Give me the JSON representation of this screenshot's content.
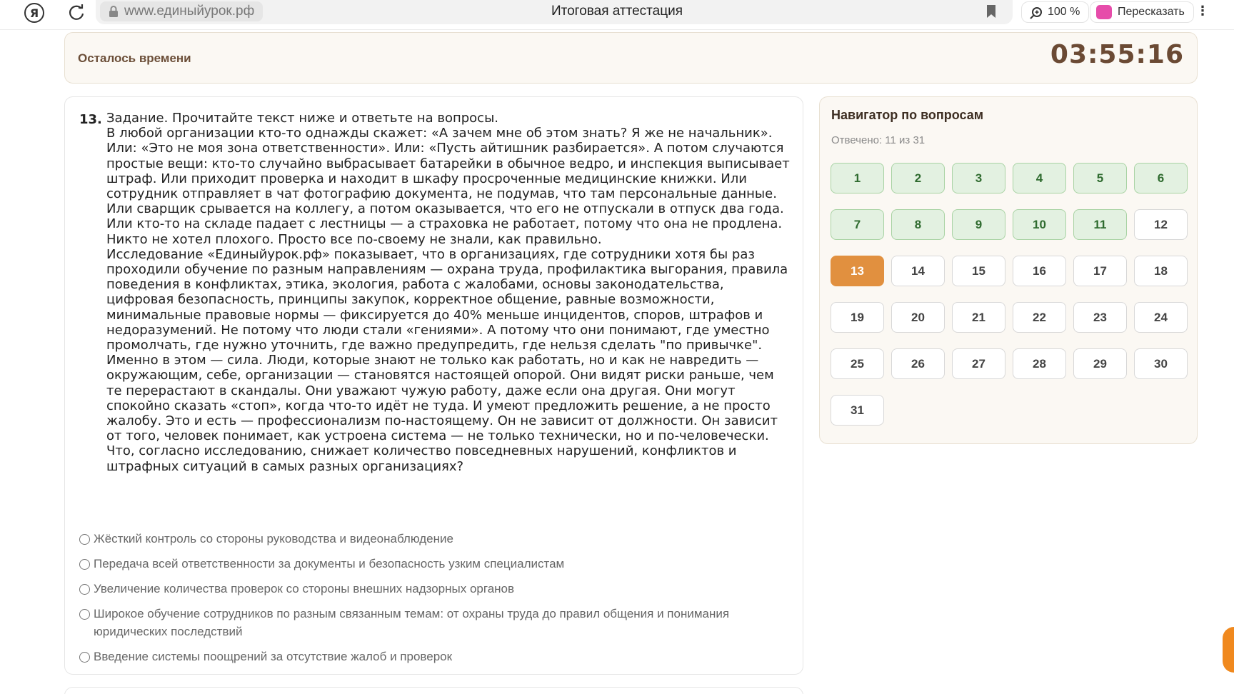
{
  "browser": {
    "url": "www.единыйурок.рф",
    "tab_title": "Итоговая аттестация",
    "zoom": "100 %",
    "retell_label": "Пересказать",
    "icons": [
      "yandex-icon",
      "reload-icon",
      "lock-icon",
      "bookmark-icon",
      "zoom-icon",
      "retell-icon",
      "menu-icon"
    ]
  },
  "timer": {
    "label": "Осталось времени",
    "value": "03:55:16"
  },
  "question": {
    "number": "13.",
    "paragraphs": [
      "Задание. Прочитайте текст ниже и ответьте на вопросы.",
      "В любой организации кто-то однажды скажет: «А зачем мне об этом знать? Я же не начальник». Или: «Это не моя зона ответственности». Или: «Пусть айтишник разбирается». А потом случаются простые вещи: кто-то случайно выбрасывает батарейки в обычное ведро, и инспекция выписывает штраф. Или приходит проверка и находит в шкафу просроченные медицинские книжки. Или сотрудник отправляет в чат фотографию документа, не подумав, что там персональные данные. Или сварщик срывается на коллегу, а потом оказывается, что его не отпускали в отпуск два года. Или кто-то на складе падает с лестницы — а страховка не работает, потому что она не продлена. Никто не хотел плохого. Просто все по-своему не знали, как правильно.",
      "Исследование «Единыйурок.рф» показывает, что в организациях, где сотрудники хотя бы раз проходили обучение по разным направлениям — охрана труда, профилактика выгорания, правила поведения в конфликтах, этика, экология, работа с жалобами, основы законодательства, цифровая безопасность, принципы закупок, корректное общение, равные возможности, минимальные правовые нормы — фиксируется до 40% меньше инцидентов, споров, штрафов и недоразумений. Не потому что люди стали «гениями». А потому что они понимают, где уместно промолчать, где нужно уточнить, где важно предупредить, где нельзя сделать \"по привычке\".",
      "Именно в этом — сила. Люди, которые знают не только как работать, но и как не навредить — окружающим, себе, организации — становятся настоящей опорой. Они видят риски раньше, чем те перерастают в скандалы. Они уважают чужую работу, даже если она другая. Они могут спокойно сказать «стоп», когда что-то идёт не туда. И умеют предложить решение, а не просто жалобу. Это и есть — профессионализм по-настоящему. Он не зависит от должности. Он зависит от того, человек понимает, как устроена система — не только технически, но и по-человечески.",
      "Что, согласно исследованию, снижает количество повседневных нарушений, конфликтов и штрафных ситуаций в самых разных организациях?"
    ],
    "options": [
      "Жёсткий контроль со стороны руководства и видеонаблюдение",
      "Передача всей ответственности за документы и безопасность узким специалистам",
      "Увеличение количества проверок со стороны внешних надзорных органов",
      "Широкое обучение сотрудников по разным связанным темам: от охраны труда до правил общения и понимания юридических последствий",
      "Введение системы поощрений за отсутствие жалоб и проверок"
    ]
  },
  "navigator": {
    "title": "Навигатор по вопросам",
    "answered_text": "Отвечено: 11 из 31",
    "current": 13,
    "items": [
      {
        "n": "1",
        "state": "answered"
      },
      {
        "n": "2",
        "state": "answered"
      },
      {
        "n": "3",
        "state": "answered"
      },
      {
        "n": "4",
        "state": "answered"
      },
      {
        "n": "5",
        "state": "answered"
      },
      {
        "n": "6",
        "state": "answered"
      },
      {
        "n": "7",
        "state": "answered"
      },
      {
        "n": "8",
        "state": "answered"
      },
      {
        "n": "9",
        "state": "answered"
      },
      {
        "n": "10",
        "state": "answered"
      },
      {
        "n": "11",
        "state": "answered"
      },
      {
        "n": "12",
        "state": "unanswered"
      },
      {
        "n": "13",
        "state": "current"
      },
      {
        "n": "14",
        "state": "unanswered"
      },
      {
        "n": "15",
        "state": "unanswered"
      },
      {
        "n": "16",
        "state": "unanswered"
      },
      {
        "n": "17",
        "state": "unanswered"
      },
      {
        "n": "18",
        "state": "unanswered"
      },
      {
        "n": "19",
        "state": "unanswered"
      },
      {
        "n": "20",
        "state": "unanswered"
      },
      {
        "n": "21",
        "state": "unanswered"
      },
      {
        "n": "22",
        "state": "unanswered"
      },
      {
        "n": "23",
        "state": "unanswered"
      },
      {
        "n": "24",
        "state": "unanswered"
      },
      {
        "n": "25",
        "state": "unanswered"
      },
      {
        "n": "26",
        "state": "unanswered"
      },
      {
        "n": "27",
        "state": "unanswered"
      },
      {
        "n": "28",
        "state": "unanswered"
      },
      {
        "n": "29",
        "state": "unanswered"
      },
      {
        "n": "30",
        "state": "unanswered"
      },
      {
        "n": "31",
        "state": "unanswered"
      }
    ]
  },
  "colors": {
    "accent_current": "#e1903f",
    "answered_bg": "#e3f1e1",
    "answered_text": "#2f6b2f",
    "timer_text": "#6b4a34"
  }
}
